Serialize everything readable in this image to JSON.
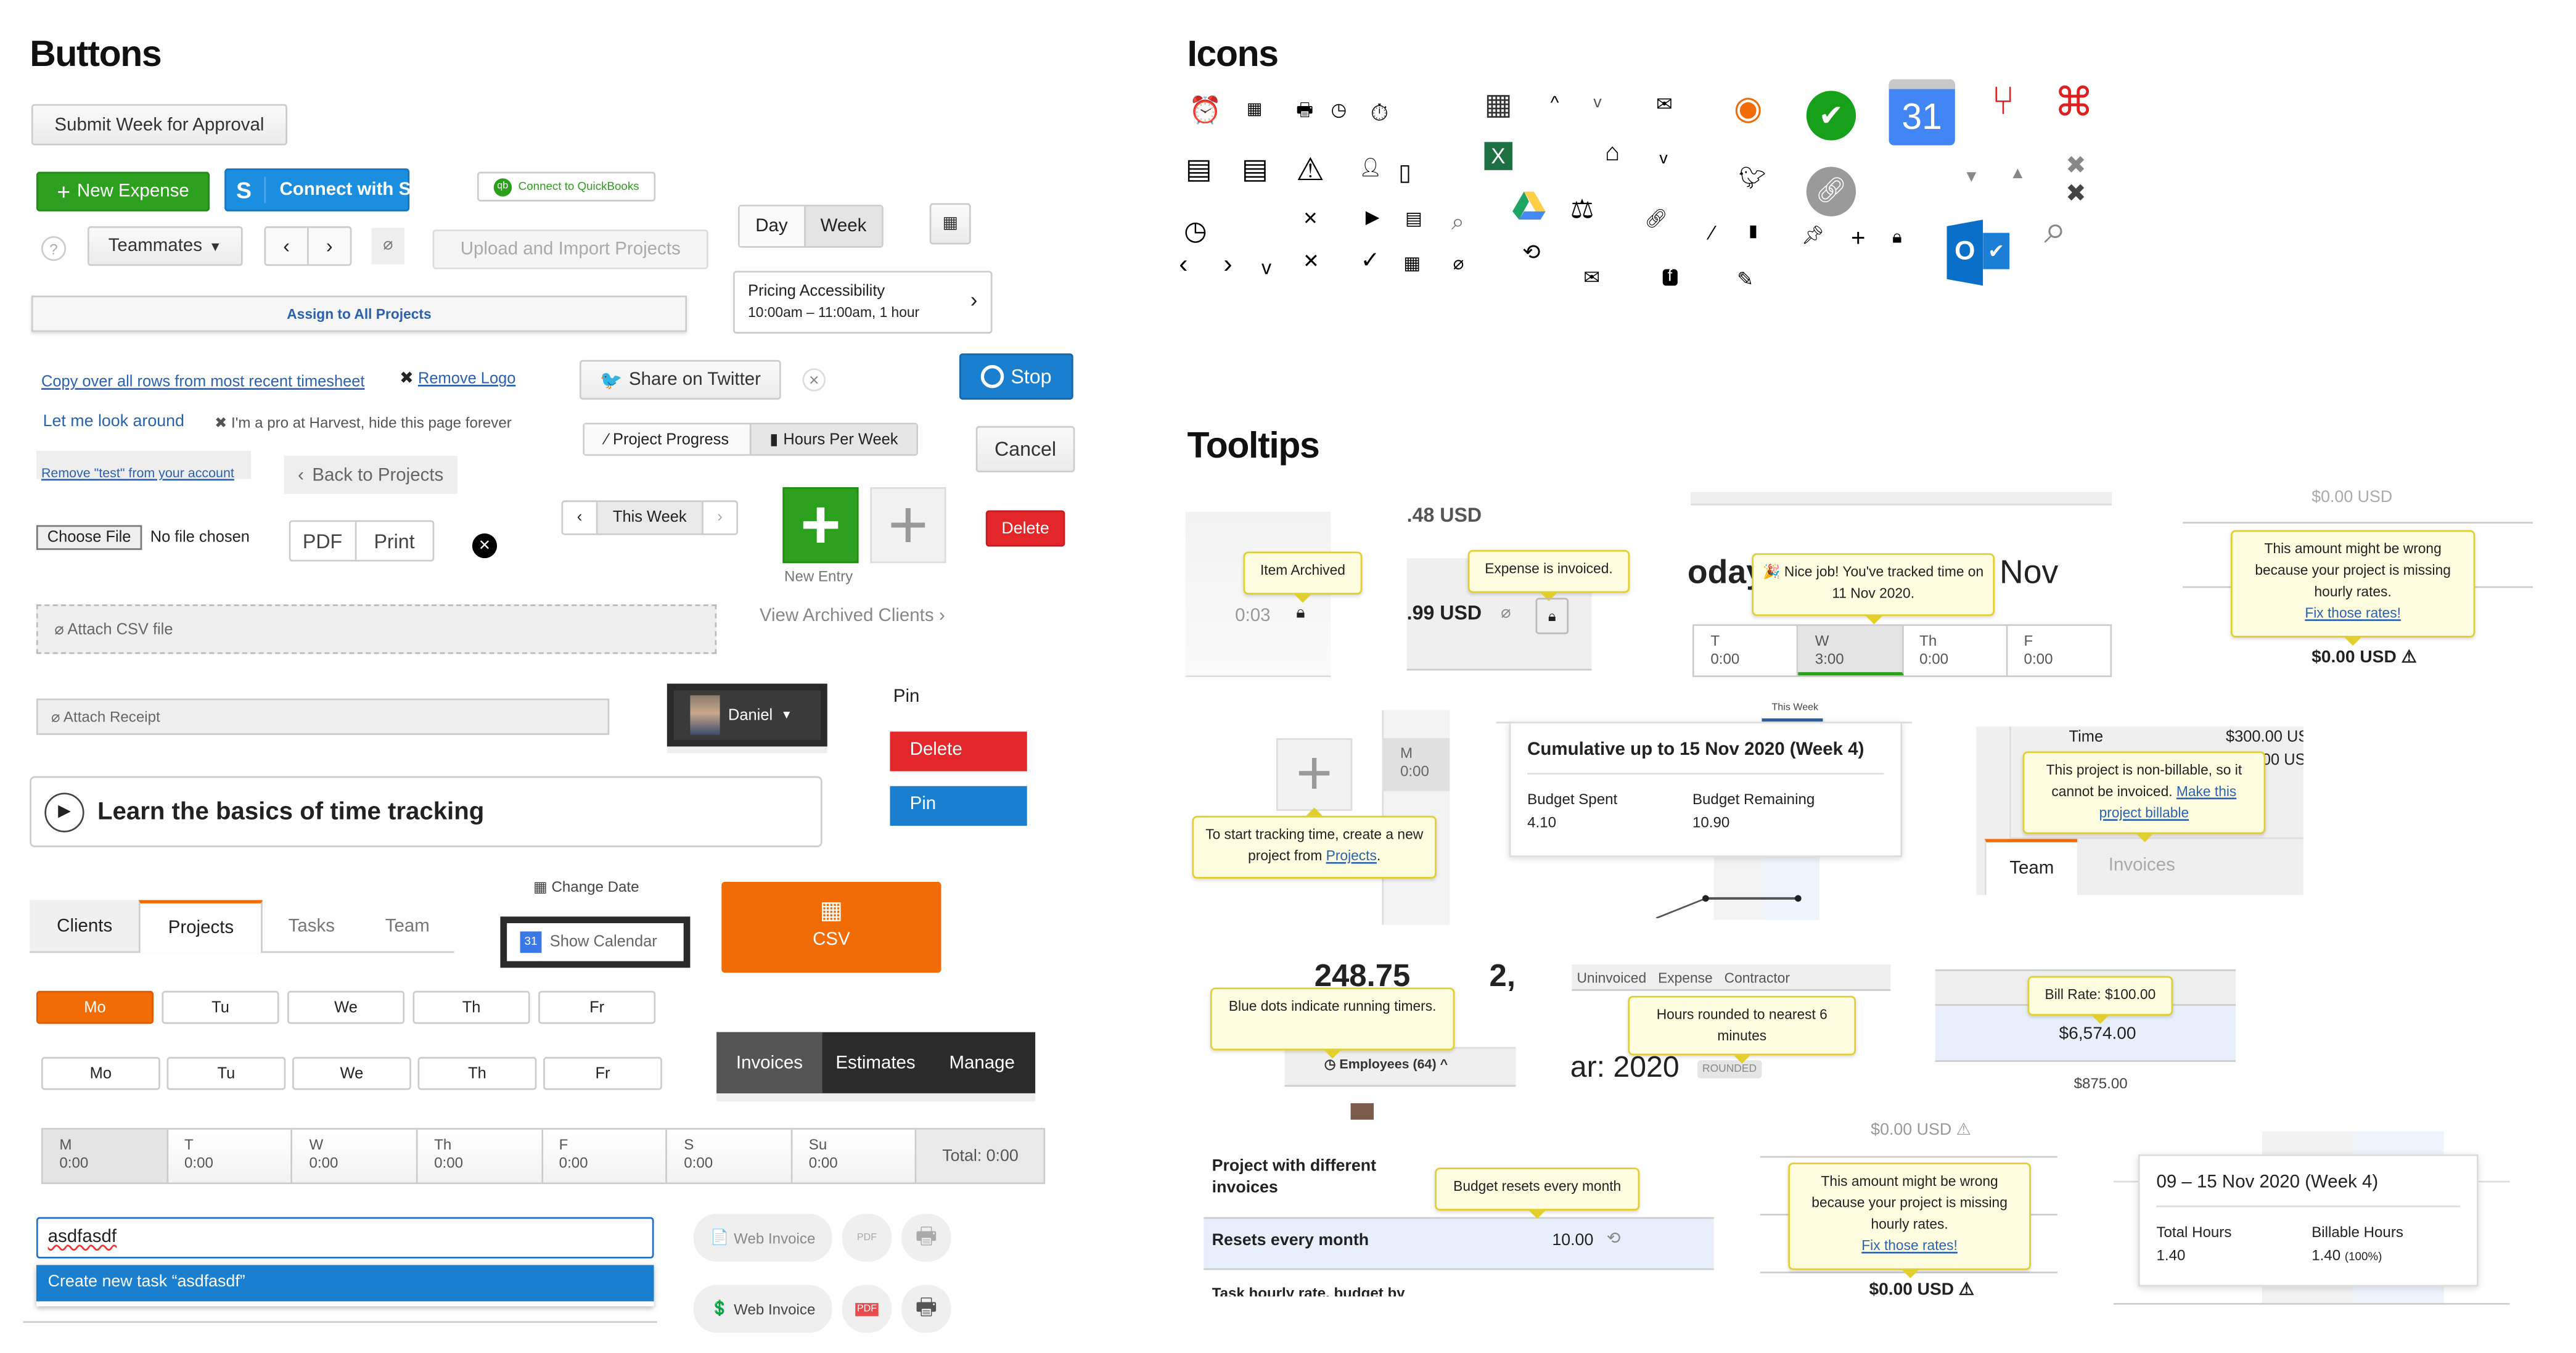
{
  "buttons": {
    "title": "Buttons",
    "submit_week": "Submit Week for Approval",
    "new_expense": "New Expense",
    "connect_stripe": "Connect with Stripe",
    "connect_quickbooks": "Connect to QuickBooks",
    "day": "Day",
    "week": "Week",
    "teammates": "Teammates",
    "upload_import": "Upload and Import Projects",
    "pricing_title": "Pricing Accessibility",
    "pricing_time": "10:00am – 11:00am, 1 hour",
    "assign_all": "Assign to All Projects",
    "copy_rows": "Copy over all rows from most recent timesheet",
    "remove_logo": "Remove Logo",
    "share_twitter": "Share on Twitter",
    "stop": "Stop",
    "let_me_look": "Let me look around",
    "pro_hide": "I'm a pro at Harvest, hide this page forever",
    "project_progress": "Project Progress",
    "hours_per_week": "Hours Per Week",
    "cancel": "Cancel",
    "remove_test": "Remove \"test\" from your account",
    "back_projects": "Back to Projects",
    "this_week": "This Week",
    "new_entry": "New Entry",
    "delete": "Delete",
    "choose_file": "Choose File",
    "no_file": "No file chosen",
    "pdf": "PDF",
    "print": "Print",
    "attach_csv": "Attach CSV file",
    "view_archived": "View Archived Clients",
    "attach_receipt": "Attach Receipt",
    "user_name": "Daniel",
    "pin_label": "Pin",
    "delete2": "Delete",
    "pin": "Pin",
    "learn": "Learn the basics of time tracking",
    "tabs": [
      "Clients",
      "Projects",
      "Tasks",
      "Team"
    ],
    "active_tab": "Projects",
    "change_date": "Change Date",
    "show_calendar": "Show Calendar",
    "calendar_day": "31",
    "csv": "CSV",
    "days1": [
      "Mo",
      "Tu",
      "We",
      "Th",
      "Fr"
    ],
    "days2": [
      "Mo",
      "Tu",
      "We",
      "Th",
      "Fr"
    ],
    "nav": [
      "Invoices",
      "Estimates",
      "Manage"
    ],
    "week_grid": [
      {
        "d": "M",
        "t": "0:00"
      },
      {
        "d": "T",
        "t": "0:00"
      },
      {
        "d": "W",
        "t": "0:00"
      },
      {
        "d": "Th",
        "t": "0:00"
      },
      {
        "d": "F",
        "t": "0:00"
      },
      {
        "d": "S",
        "t": "0:00"
      },
      {
        "d": "Su",
        "t": "0:00"
      }
    ],
    "total": "Total: 0:00",
    "task_input": "asdfasdf",
    "create_task": "Create new task “asdfasdf”",
    "web_invoice": "Web Invoice",
    "pdf_icon": "PDF"
  },
  "colors": {
    "green": "#2da01f",
    "blue": "#1b7fd0",
    "orange": "#f26c05",
    "red": "#e3262a",
    "tooltip_bg": "#fffde0",
    "tooltip_border": "#e2cf2e",
    "link": "#2a62b0"
  },
  "icons": {
    "title": "Icons",
    "calendar_day": "31"
  },
  "tooltips": {
    "title": "Tooltips",
    "item_archived": "Item Archived",
    "time_003": "0:03",
    "usd_48": ".48 USD",
    "expense_invoiced": "Expense is invoiced.",
    "usd_99": ".99 USD",
    "today_frag": "oday",
    "nov_frag": "Nov",
    "nice_job": "Nice job! You've tracked time on 11 Nov 2020.",
    "week_strip": [
      {
        "d": "T",
        "t": "0:00"
      },
      {
        "d": "W",
        "t": "3:00"
      },
      {
        "d": "Th",
        "t": "0:00"
      },
      {
        "d": "F",
        "t": "0:00"
      }
    ],
    "usd_zero": "$0.00 USD",
    "rates_wrong": "This amount might be wrong because your project is missing hourly rates.",
    "fix_rates": "Fix those rates!",
    "this_week": "This Week",
    "cumulative": "Cumulative up to 15 Nov 2020 (Week 4)",
    "budget_spent": "Budget Spent",
    "budget_spent_val": "4.10",
    "budget_remaining": "Budget Remaining",
    "budget_remaining_val": "10.90",
    "grid_m": "M",
    "grid_m_t": "0:00",
    "start_tracking": "To start tracking time, create a new project from ",
    "projects_link": "Projects",
    "time": "Time",
    "time_val": "$300.00 US",
    "time_val2": "00 US",
    "non_billable": "This project is non-billable, so it cannot be invoiced. ",
    "make_billable": "Make this project billable",
    "team": "Team",
    "invoices": "Invoices",
    "big_num": "248.75",
    "big_num2": "2,",
    "blue_dots": "Blue dots indicate running timers.",
    "employees": "Employees (64)",
    "col_heads": "Uninvoiced   Expense   Contractor",
    "hours_rounded": "Hours rounded to nearest 6 minutes",
    "year": "ar: 2020",
    "rounded": "ROUNDED",
    "bill_rate": "Bill Rate: $100.00",
    "amount1": "$6,574.00",
    "amount2": "$875.00",
    "proj_diff": "Project with different invoices",
    "budget_resets": "Budget resets every month",
    "resets_month": "Resets every month",
    "resets_val": "10.00",
    "task_rate": "Task hourly rate, budget by",
    "week_range": "09 – 15 Nov 2020 (Week 4)",
    "total_hours": "Total Hours",
    "total_hours_val": "1.40",
    "billable_hours": "Billable Hours",
    "billable_hours_val": "1.40",
    "billable_pct": "(100%)"
  }
}
